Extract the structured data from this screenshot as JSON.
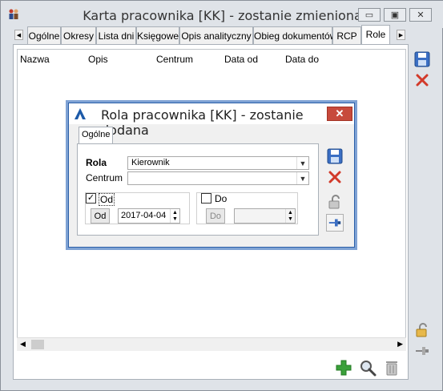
{
  "window": {
    "title": "Karta pracownika [KK] - zostanie zmieniona",
    "minimize": "▭",
    "maximize": "▣",
    "close": "✕"
  },
  "tabs": [
    "Ogólne",
    "Okresy",
    "Lista dni",
    "Księgowe",
    "Opis analityczny",
    "Obieg dokumentów",
    "RCP",
    "Role"
  ],
  "active_tab": "Role",
  "grid": {
    "columns": [
      "Nazwa",
      "Opis",
      "Centrum",
      "Data od",
      "Data do"
    ]
  },
  "dialog": {
    "title": "Rola pracownika [KK] - zostanie dodana",
    "close": "✕",
    "tab": "Ogólne",
    "rola_label": "Rola",
    "rola_value": "Kierownik",
    "centrum_label": "Centrum",
    "centrum_value": "",
    "od_checkbox_label": "Od",
    "od_checked": "✓",
    "od_button": "Od",
    "od_date": "2017-04-04",
    "do_checkbox_label": "Do",
    "do_button": "Do",
    "do_date": ""
  },
  "icons": {
    "save": "save-icon",
    "cancel": "cancel-icon",
    "lock": "lock-icon",
    "pin": "pin-icon",
    "add": "add-icon",
    "search": "search-icon",
    "delete": "trash-icon"
  },
  "colors": {
    "accent_blue": "#2b5fa8",
    "close_red": "#c74a3c",
    "add_green": "#3aa03a"
  }
}
